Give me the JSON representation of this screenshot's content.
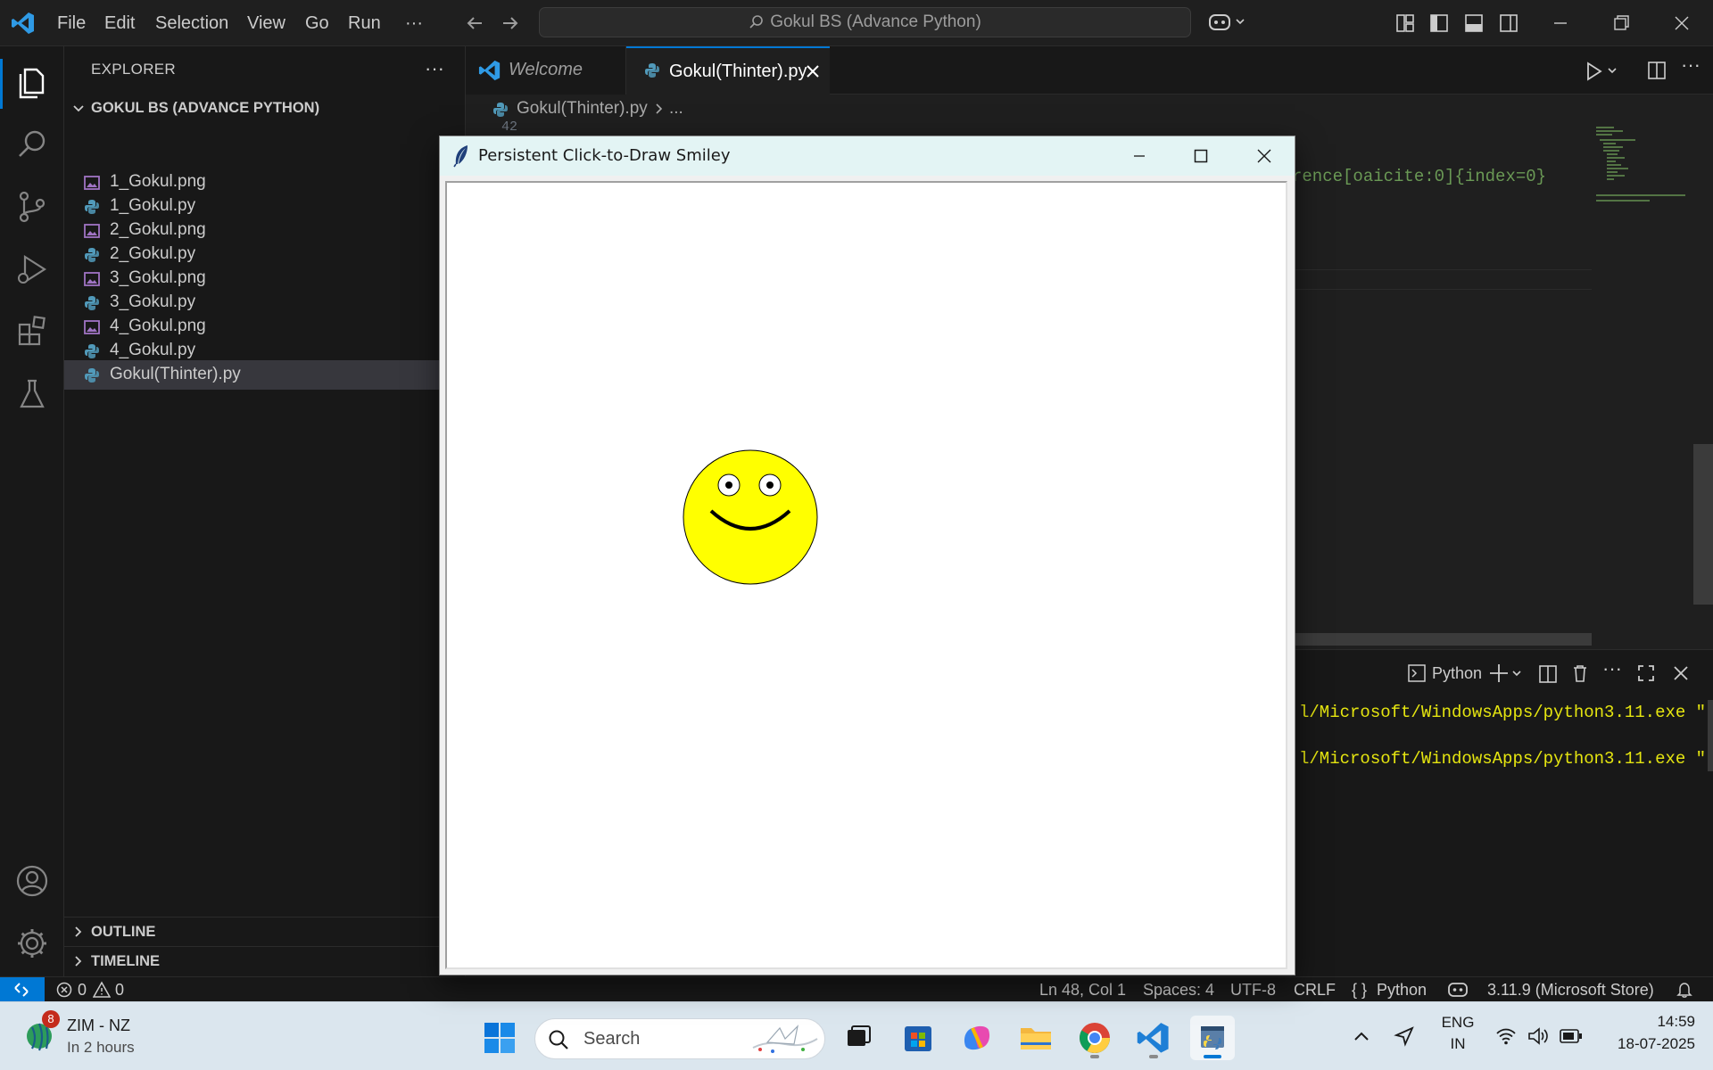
{
  "titlebar": {
    "menu": [
      "File",
      "Edit",
      "Selection",
      "View",
      "Go",
      "Run",
      "···"
    ],
    "command_center": "Gokul BS (Advance Python)"
  },
  "sidebar": {
    "title": "EXPLORER",
    "more": "···",
    "folder": "GOKUL BS (ADVANCE PYTHON)",
    "files": [
      {
        "name": "1_Gokul.png",
        "kind": "image"
      },
      {
        "name": "1_Gokul.py",
        "kind": "python"
      },
      {
        "name": "2_Gokul.png",
        "kind": "image"
      },
      {
        "name": "2_Gokul.py",
        "kind": "python"
      },
      {
        "name": "3_Gokul.png",
        "kind": "image"
      },
      {
        "name": "3_Gokul.py",
        "kind": "python"
      },
      {
        "name": "4_Gokul.png",
        "kind": "image"
      },
      {
        "name": "4_Gokul.py",
        "kind": "python"
      },
      {
        "name": "Gokul(Thinter).py",
        "kind": "python",
        "active": true
      }
    ],
    "outline": "OUTLINE",
    "timeline": "TIMELINE"
  },
  "tabs": [
    {
      "label": "Welcome",
      "active": false
    },
    {
      "label": "Gokul(Thinter).py",
      "active": true
    }
  ],
  "breadcrumb": {
    "file": "Gokul(Thinter).py",
    "rest": "...",
    "line_number": "42"
  },
  "editor": {
    "visible_code": "rence[oaicite:0]{index=0}"
  },
  "panel": {
    "terminal_name": "Python",
    "lines": [
      "l/Microsoft/WindowsApps/python3.11.exe \"",
      "l/Microsoft/WindowsApps/python3.11.exe \""
    ]
  },
  "statusbar": {
    "errors": "0",
    "warnings": "0",
    "position": "Ln 48, Col 1",
    "spaces": "Spaces: 4",
    "encoding": "UTF-8",
    "eol": "CRLF",
    "language_icon": "{ }",
    "language": "Python",
    "interpreter": "3.11.9 (Microsoft Store)"
  },
  "tkwindow": {
    "title": "Persistent Click-to-Draw Smiley",
    "face_color": "#ffff00"
  },
  "taskbar": {
    "widget_badge": "8",
    "widget_title": "ZIM - NZ",
    "widget_sub": "In 2 hours",
    "search_placeholder": "Search",
    "lang_top": "ENG",
    "lang_bottom": "IN",
    "time": "14:59",
    "date": "18-07-2025"
  },
  "colors": {
    "accent": "#0078d4",
    "terminal_text": "#e5e510",
    "comment": "#6a9955"
  }
}
